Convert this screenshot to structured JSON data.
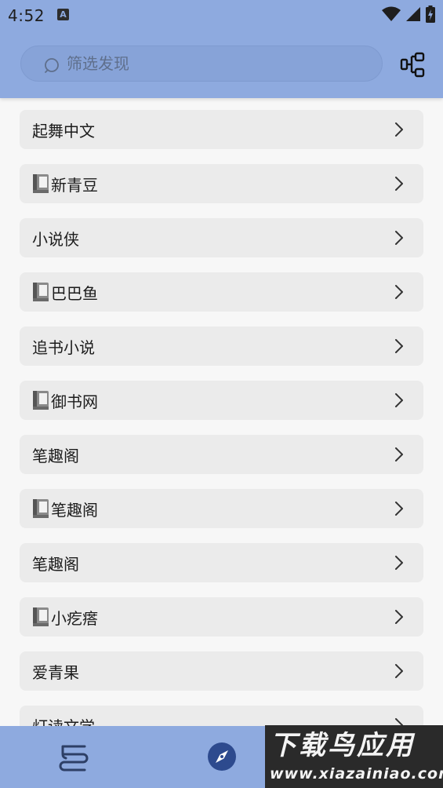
{
  "status_bar": {
    "time": "4:52",
    "notification_glyph": "A",
    "icons": [
      "wifi-icon",
      "signal-icon",
      "battery-charging-icon"
    ]
  },
  "search": {
    "placeholder": "筛选发现",
    "value": ""
  },
  "toolbar": {
    "icons": [
      "search-icon",
      "tree-structure-icon"
    ]
  },
  "sources": [
    {
      "label": "起舞中文",
      "book_icon": false
    },
    {
      "label": "新青豆",
      "book_icon": true
    },
    {
      "label": "小说侠",
      "book_icon": false
    },
    {
      "label": "巴巴鱼",
      "book_icon": true
    },
    {
      "label": "追书小说",
      "book_icon": false
    },
    {
      "label": "御书网",
      "book_icon": true
    },
    {
      "label": "笔趣阁",
      "book_icon": false
    },
    {
      "label": "笔趣阁",
      "book_icon": true
    },
    {
      "label": "笔趣阁",
      "book_icon": false
    },
    {
      "label": "小疙瘩",
      "book_icon": true
    },
    {
      "label": "爱青果",
      "book_icon": false
    },
    {
      "label": "灯读文学",
      "book_icon": false
    }
  ],
  "bottom_nav": {
    "items": [
      "bookshelf-icon",
      "discover-compass-icon"
    ],
    "active": "discover-compass-icon"
  },
  "watermark": {
    "main": "下载鸟应用",
    "sub": "www.xiazainiao.com"
  },
  "colors": {
    "header": "#8eaadf",
    "row_background": "#ebebeb",
    "page_background": "#f7f7f7",
    "accent": "#2d4a8e"
  }
}
